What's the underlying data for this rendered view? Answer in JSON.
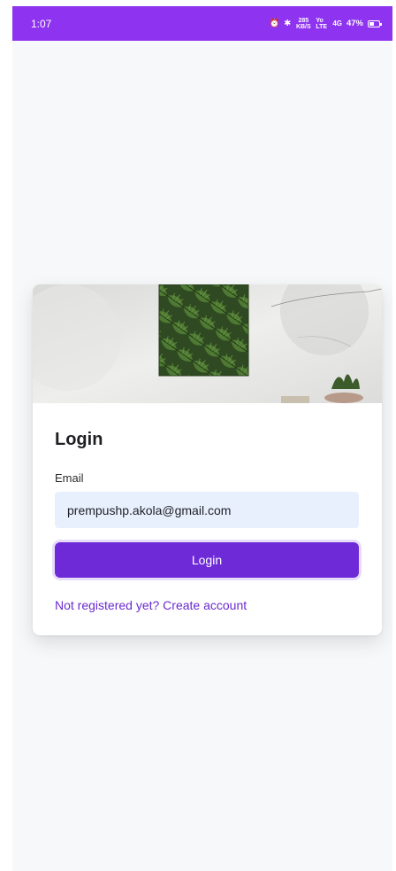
{
  "status_bar": {
    "time": "1:07",
    "alarm_icon": "alarm-icon",
    "bluetooth_icon": "bluetooth-icon",
    "network_speed": "285 KB/S",
    "volte": "Yo LTE",
    "signal": "4G",
    "battery_percent": "47%",
    "background_color": "#8e33f0"
  },
  "card": {
    "image": "wall-art-with-monstera-leaves-and-plant",
    "title": "Login",
    "email_label": "Email",
    "email_value": "prempushp.akola@gmail.com",
    "login_button_label": "Login",
    "register_link": "Not registered yet? Create account",
    "accent_color": "#6f2ad8"
  }
}
